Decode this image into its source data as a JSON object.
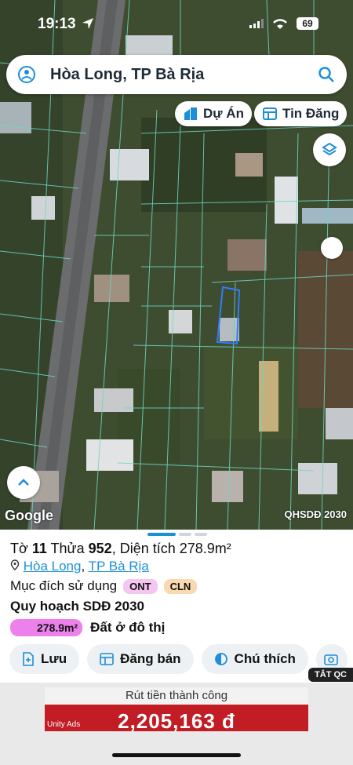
{
  "status_bar": {
    "time": "19:13",
    "battery": "69"
  },
  "search": {
    "query": "Hòa Long, TP Bà Rịa"
  },
  "chips": {
    "du_an": "Dự Án",
    "tin_dang": "Tin Đăng"
  },
  "map": {
    "attribution": "Google",
    "plan_label": "QHSDĐ 2030"
  },
  "parcel": {
    "sheet_label": "Tờ",
    "sheet_no": "11",
    "plot_label": "Thửa",
    "plot_no": "952",
    "area_text": "Diện tích 278.9m²",
    "ward": "Hòa Long",
    "city": "TP Bà Rịa",
    "purpose_label": "Mục đích sử dụng",
    "purposes": [
      "ONT",
      "CLN"
    ],
    "plan_title": "Quy hoạch SDĐ 2030",
    "plan_area": "278.9m²",
    "plan_desc": "Đất ở đô thị"
  },
  "actions": {
    "save": "Lưu",
    "sell": "Đăng bán",
    "legend": "Chú thích"
  },
  "ads": {
    "hide_label": "TẮT QC",
    "headline": "Rút tiền thành công",
    "amount": "2,205,163 đ",
    "provider": "Unity Ads"
  },
  "colors": {
    "accent": "#1d8fd6",
    "plan_pink": "#ec81ec",
    "badge_ont": "#f5c6f0",
    "badge_cln": "#f8d9b0"
  }
}
